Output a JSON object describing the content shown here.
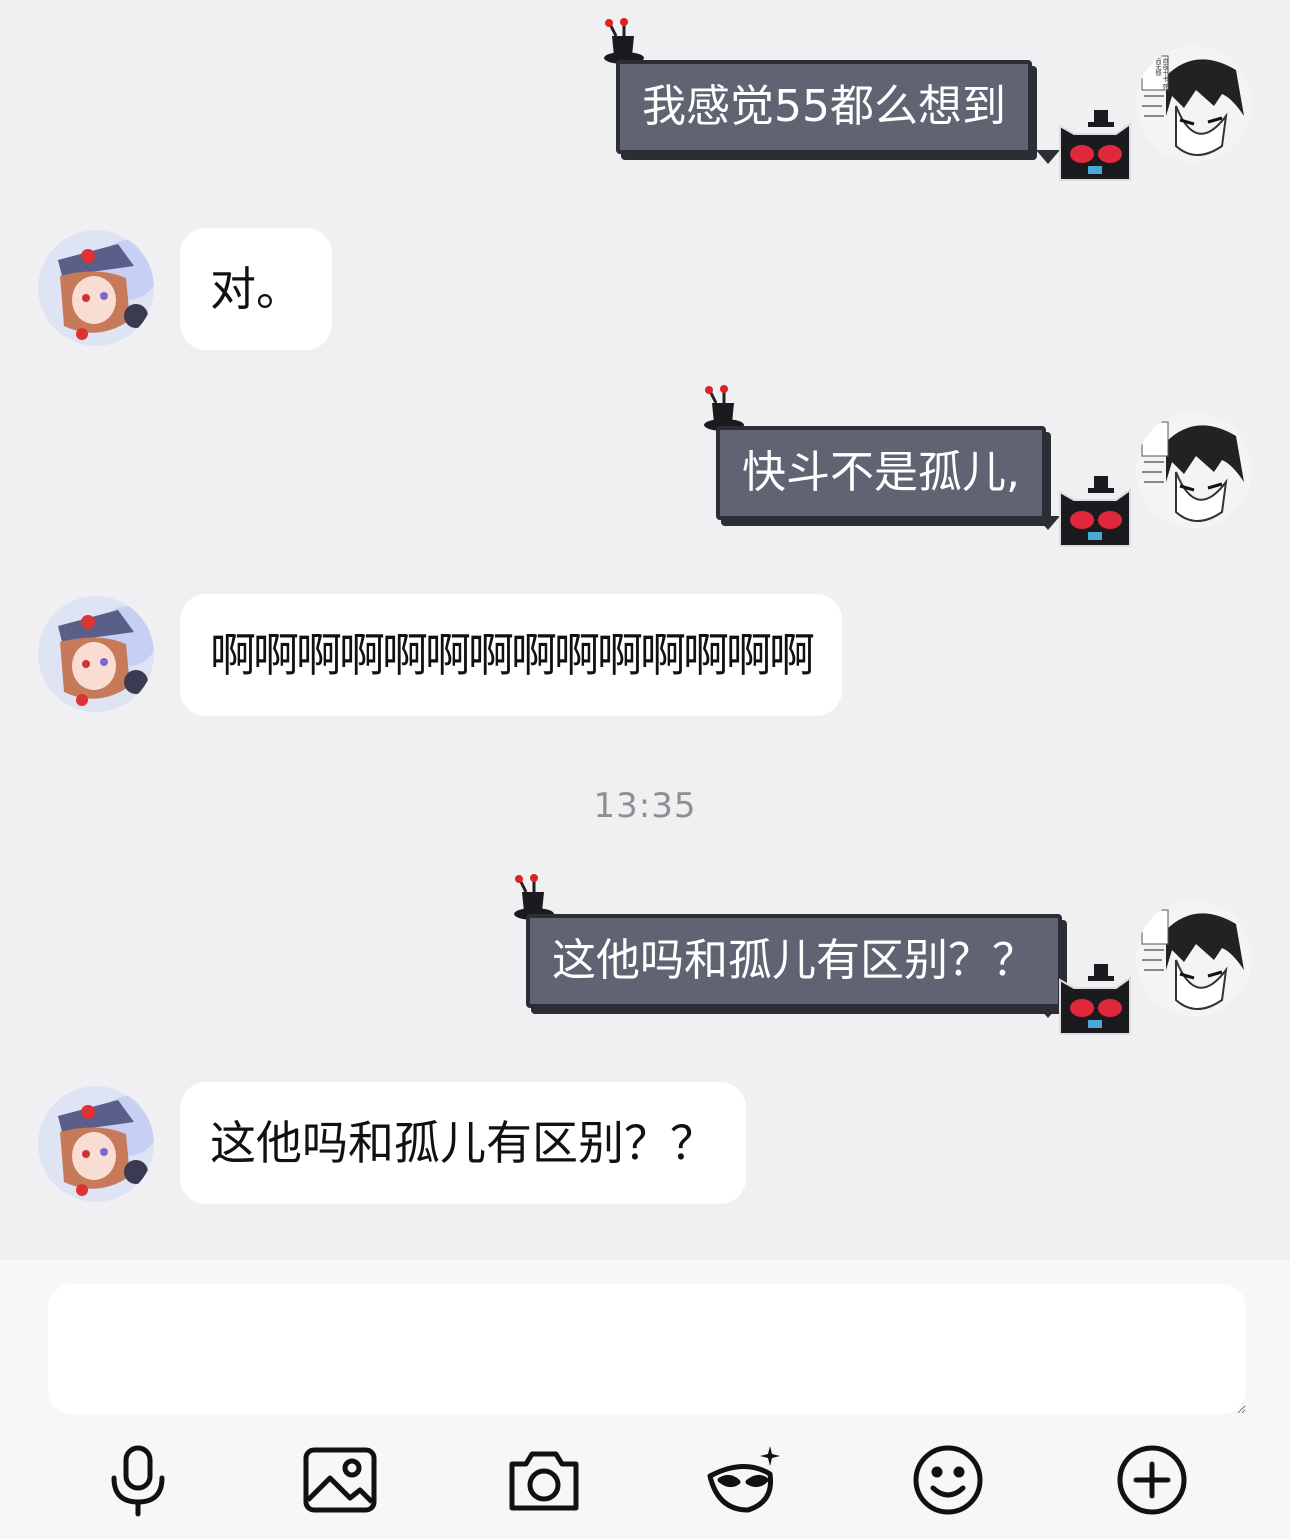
{
  "messages": [
    {
      "side": "out",
      "text": "我感觉55都么想到"
    },
    {
      "side": "in",
      "text": "对。"
    },
    {
      "side": "out",
      "text": "快斗不是孤儿,"
    },
    {
      "side": "in",
      "text": "啊啊啊啊啊啊啊啊啊啊啊啊啊啊"
    },
    {
      "side": "out",
      "text": "这他吗和孤儿有区别？？"
    },
    {
      "side": "in",
      "text": "这他吗和孤儿有区别？？"
    }
  ],
  "timestamp": "13:35",
  "my_avatar_text": "命夜十卡 死而无憾",
  "composer": {
    "value": ""
  },
  "toolbar": {
    "icons": [
      "microphone-icon",
      "image-icon",
      "camera-icon",
      "mask-sparkle-icon",
      "emoji-icon",
      "plus-icon"
    ]
  },
  "colors": {
    "background": "#f0f0f2",
    "bubble_in": "#ffffff",
    "bubble_out": "#5f6372",
    "bubble_out_border": "#2c2e35",
    "timestamp": "#8e8e93"
  }
}
